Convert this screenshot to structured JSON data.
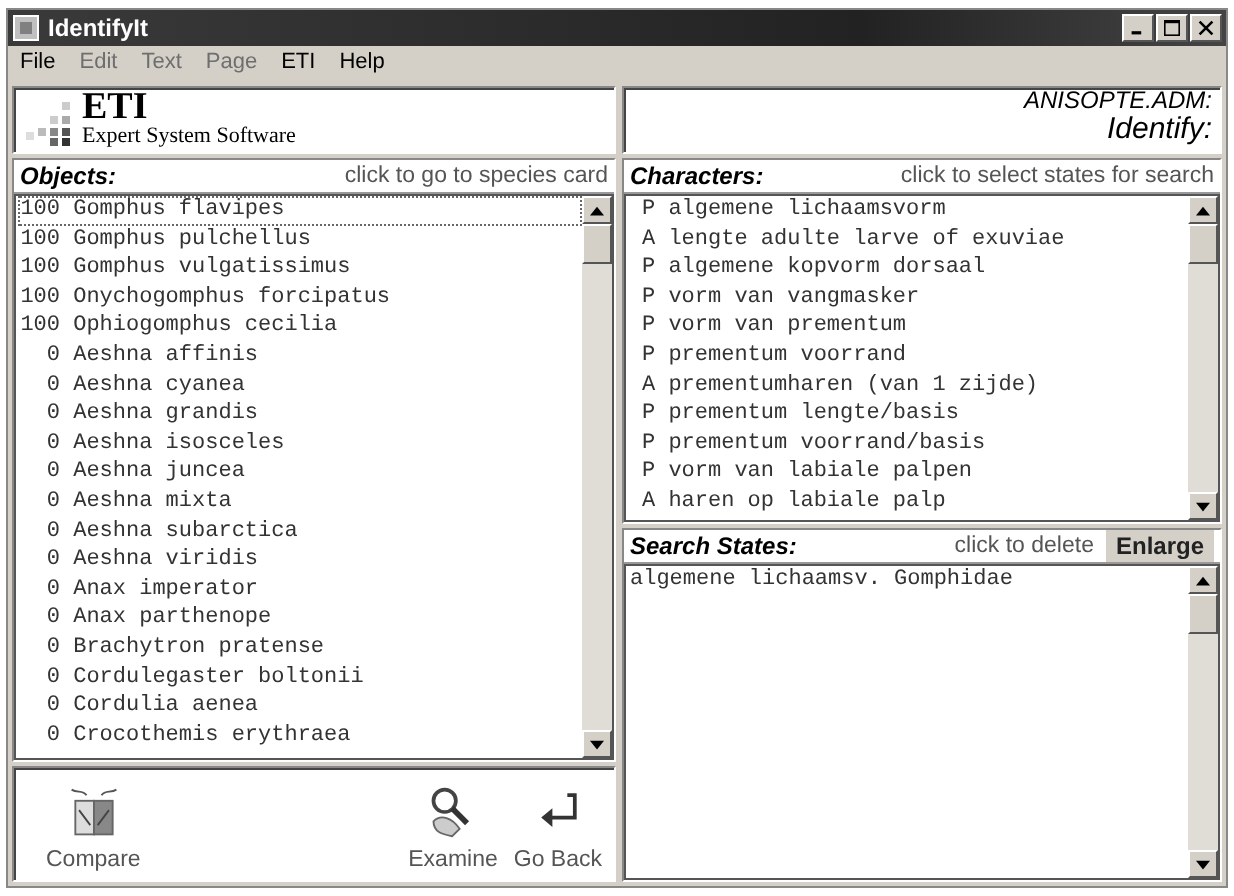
{
  "window": {
    "title": "IdentifyIt"
  },
  "menu": [
    {
      "label": "File",
      "disabled": false
    },
    {
      "label": "Edit",
      "disabled": true
    },
    {
      "label": "Text",
      "disabled": true
    },
    {
      "label": "Page",
      "disabled": true
    },
    {
      "label": "ETI",
      "disabled": false
    },
    {
      "label": "Help",
      "disabled": false
    }
  ],
  "logo": {
    "name": "ETI",
    "tagline": "Expert System Software"
  },
  "file_info": {
    "file": "ANISOPTE.ADM:",
    "mode": "Identify:"
  },
  "objects": {
    "title": "Objects:",
    "hint": "click to go to species card",
    "items": [
      {
        "score": "100",
        "name": "Gomphus flavipes",
        "selected": true
      },
      {
        "score": "100",
        "name": "Gomphus pulchellus",
        "selected": false
      },
      {
        "score": "100",
        "name": "Gomphus vulgatissimus",
        "selected": false
      },
      {
        "score": "100",
        "name": "Onychogomphus forcipatus",
        "selected": false
      },
      {
        "score": "100",
        "name": "Ophiogomphus cecilia",
        "selected": false
      },
      {
        "score": "0",
        "name": "Aeshna affinis",
        "selected": false
      },
      {
        "score": "0",
        "name": "Aeshna cyanea",
        "selected": false
      },
      {
        "score": "0",
        "name": "Aeshna grandis",
        "selected": false
      },
      {
        "score": "0",
        "name": "Aeshna isosceles",
        "selected": false
      },
      {
        "score": "0",
        "name": "Aeshna juncea",
        "selected": false
      },
      {
        "score": "0",
        "name": "Aeshna mixta",
        "selected": false
      },
      {
        "score": "0",
        "name": "Aeshna subarctica",
        "selected": false
      },
      {
        "score": "0",
        "name": "Aeshna viridis",
        "selected": false
      },
      {
        "score": "0",
        "name": "Anax imperator",
        "selected": false
      },
      {
        "score": "0",
        "name": "Anax parthenope",
        "selected": false
      },
      {
        "score": "0",
        "name": "Brachytron pratense",
        "selected": false
      },
      {
        "score": "0",
        "name": "Cordulegaster boltonii",
        "selected": false
      },
      {
        "score": "0",
        "name": "Cordulia aenea",
        "selected": false
      },
      {
        "score": "0",
        "name": "Crocothemis erythraea",
        "selected": false
      }
    ]
  },
  "tools": [
    {
      "label": "Compare",
      "kind": "compare"
    },
    {
      "label": "Examine",
      "kind": "examine"
    },
    {
      "label": "Go Back",
      "kind": "back"
    }
  ],
  "characters": {
    "title": "Characters:",
    "hint": "click to select states for search",
    "items": [
      {
        "type": "P",
        "name": "algemene lichaamsvorm"
      },
      {
        "type": "A",
        "name": "lengte adulte larve of exuviae"
      },
      {
        "type": "P",
        "name": "algemene kopvorm dorsaal"
      },
      {
        "type": "P",
        "name": "vorm van vangmasker"
      },
      {
        "type": "P",
        "name": "vorm van prementum"
      },
      {
        "type": "P",
        "name": "prementum voorrand"
      },
      {
        "type": "A",
        "name": "prementumharen (van 1 zijde)"
      },
      {
        "type": "P",
        "name": "prementum lengte/basis"
      },
      {
        "type": "P",
        "name": "prementum voorrand/basis"
      },
      {
        "type": "P",
        "name": "vorm van labiale palpen"
      },
      {
        "type": "A",
        "name": "haren op labiale palp"
      }
    ]
  },
  "search_states": {
    "title": "Search States:",
    "hint": "click to delete",
    "button": "Enlarge",
    "items": [
      "algemene lichaamsv. Gomphidae"
    ]
  }
}
